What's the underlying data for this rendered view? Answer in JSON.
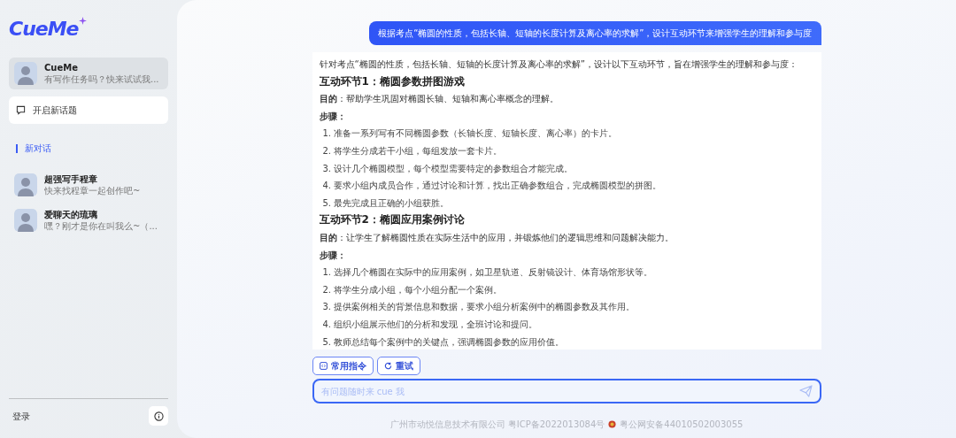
{
  "logo": "CueMe",
  "sidebar": {
    "pinned": [
      {
        "name": "CueMe",
        "preview": "有写作任务吗？快来试试我...",
        "selected": true
      }
    ],
    "new_topic_button": "开启新话题",
    "section_label": "新对话",
    "characters": [
      {
        "name": "超强写手程章",
        "preview": "快来找程章一起创作吧~",
        "selected": false
      },
      {
        "name": "爱聊天的琉璃",
        "preview": "嘿？刚才是你在叫我么~（...",
        "selected": false
      }
    ],
    "login": "登录"
  },
  "chat": {
    "user_message": "根据考点“椭圆的性质，包括长轴、短轴的长度计算及离心率的求解”，设计互动环节来增强学生的理解和参与度",
    "answer": {
      "intro": "针对考点“椭圆的性质，包括长轴、短轴的长度计算及离心率的求解”，设计以下互动环节，旨在增强学生的理解和参与度：",
      "sections": [
        {
          "title": "互动环节1：椭圆参数拼图游戏",
          "purpose": "**目的**：帮助学生巩固对椭圆长轴、短轴和离心率概念的理解。",
          "steps_label": "步骤：",
          "steps": [
            "1. 准备一系列写有不同椭圆参数（长轴长度、短轴长度、离心率）的卡片。",
            "2. 将学生分成若干小组，每组发放一套卡片。",
            "3. 设计几个椭圆模型，每个模型需要特定的参数组合才能完成。",
            "4. 要求小组内成员合作，通过讨论和计算，找出正确参数组合，完成椭圆模型的拼图。",
            "5. 最先完成且正确的小组获胜。"
          ]
        },
        {
          "title": "互动环节2：椭圆应用案例讨论",
          "purpose": "**目的**：让学生了解椭圆性质在实际生活中的应用，并锻炼他们的逻辑思维和问题解决能力。",
          "steps_label": "步骤：",
          "steps": [
            "1. 选择几个椭圆在实际中的应用案例，如卫星轨道、反射镜设计、体育场馆形状等。",
            "2. 将学生分成小组，每个小组分配一个案例。",
            "3. 提供案例相关的背景信息和数据，要求小组分析案例中的椭圆参数及其作用。",
            "4. 组织小组展示他们的分析和发现，全班讨论和提问。",
            "5. 教师总结每个案例中的关键点，强调椭圆参数的应用价值。"
          ]
        }
      ]
    }
  },
  "actions": [
    {
      "kind": "commands",
      "label": "常用指令"
    },
    {
      "kind": "retry",
      "label": "重试"
    }
  ],
  "input": {
    "placeholder": "有问题随时来 cue 我"
  },
  "footer": {
    "company": "广州市动悦信息技术有限公司 粤ICP备2022013084号",
    "police": "粤公网安备44010502003055"
  }
}
